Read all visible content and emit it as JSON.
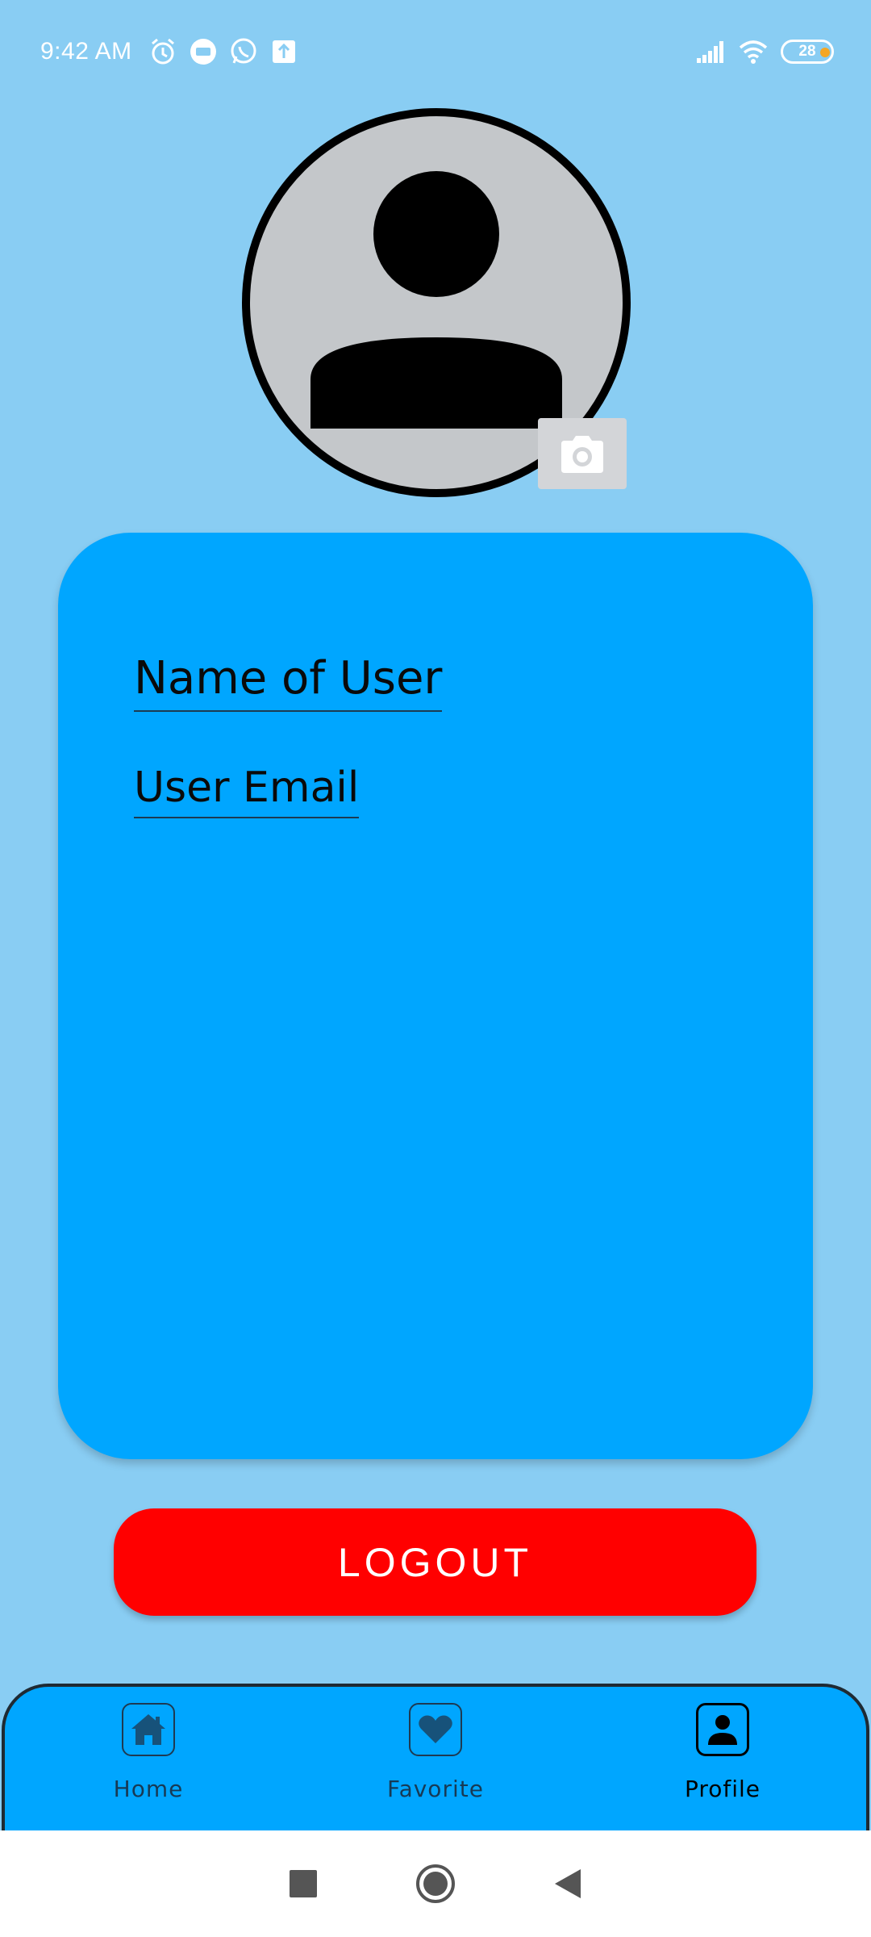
{
  "status_bar": {
    "time": "9:42 AM",
    "battery_level": "28",
    "notification_icons": [
      "alarm-icon",
      "message-icon",
      "whatsapp-icon",
      "upload-icon"
    ],
    "system_icons": [
      "signal-icon",
      "wifi-icon",
      "battery-icon"
    ]
  },
  "profile": {
    "avatar_icon": "person-placeholder-icon",
    "camera_icon": "camera-icon",
    "name": "Name of User",
    "email": "User Email"
  },
  "actions": {
    "logout_label": "LOGOUT"
  },
  "bottom_nav": {
    "items": [
      {
        "label": "Home",
        "icon": "home-icon"
      },
      {
        "label": "Favorite",
        "icon": "heart-icon"
      },
      {
        "label": "Profile",
        "icon": "profile-icon"
      }
    ],
    "active": "Profile"
  },
  "system_nav": {
    "buttons": [
      "recents-button",
      "home-button",
      "back-button"
    ]
  },
  "colors": {
    "background": "#89CDF3",
    "card": "#00A6FF",
    "logout": "#FF0000",
    "nav_bar": "#00A6FF",
    "avatar_bg": "#C4C7CA",
    "battery_charge": "#F5A623"
  }
}
